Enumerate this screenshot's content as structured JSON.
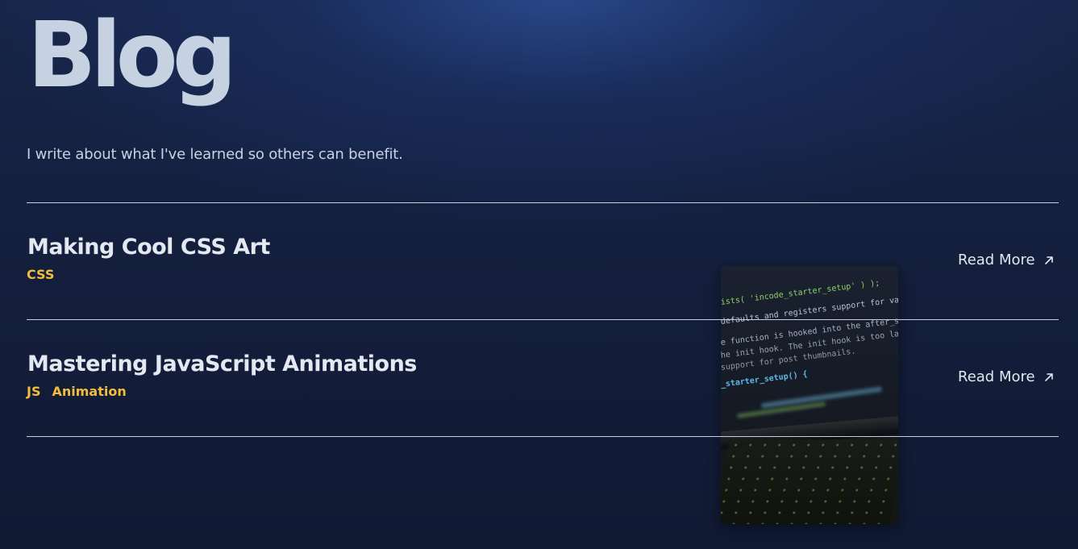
{
  "header": {
    "title": "Blog",
    "subtitle": "I write about what I've learned so others can benefit."
  },
  "posts": [
    {
      "title": "Making Cool CSS Art",
      "tags": [
        "CSS"
      ],
      "read_more_label": "Read More"
    },
    {
      "title": "Mastering JavaScript Animations",
      "tags": [
        "JS",
        "Animation"
      ],
      "read_more_label": "Read More"
    }
  ],
  "thumbnail": {
    "code_lines": [
      "ists( 'incode_starter_setup' ) );",
      "defaults and registers support for various W",
      "e function is hooked into the after_setup_theme",
      "he init hook. The init hook is too late for some",
      "support for post thumbnails.",
      "_starter_setup() {"
    ]
  },
  "colors": {
    "accent_tag": "#f2bd3a",
    "background": "#141f3d",
    "title": "#c6d2e2"
  },
  "icons": {
    "read_more": "arrow-up-right-icon"
  }
}
